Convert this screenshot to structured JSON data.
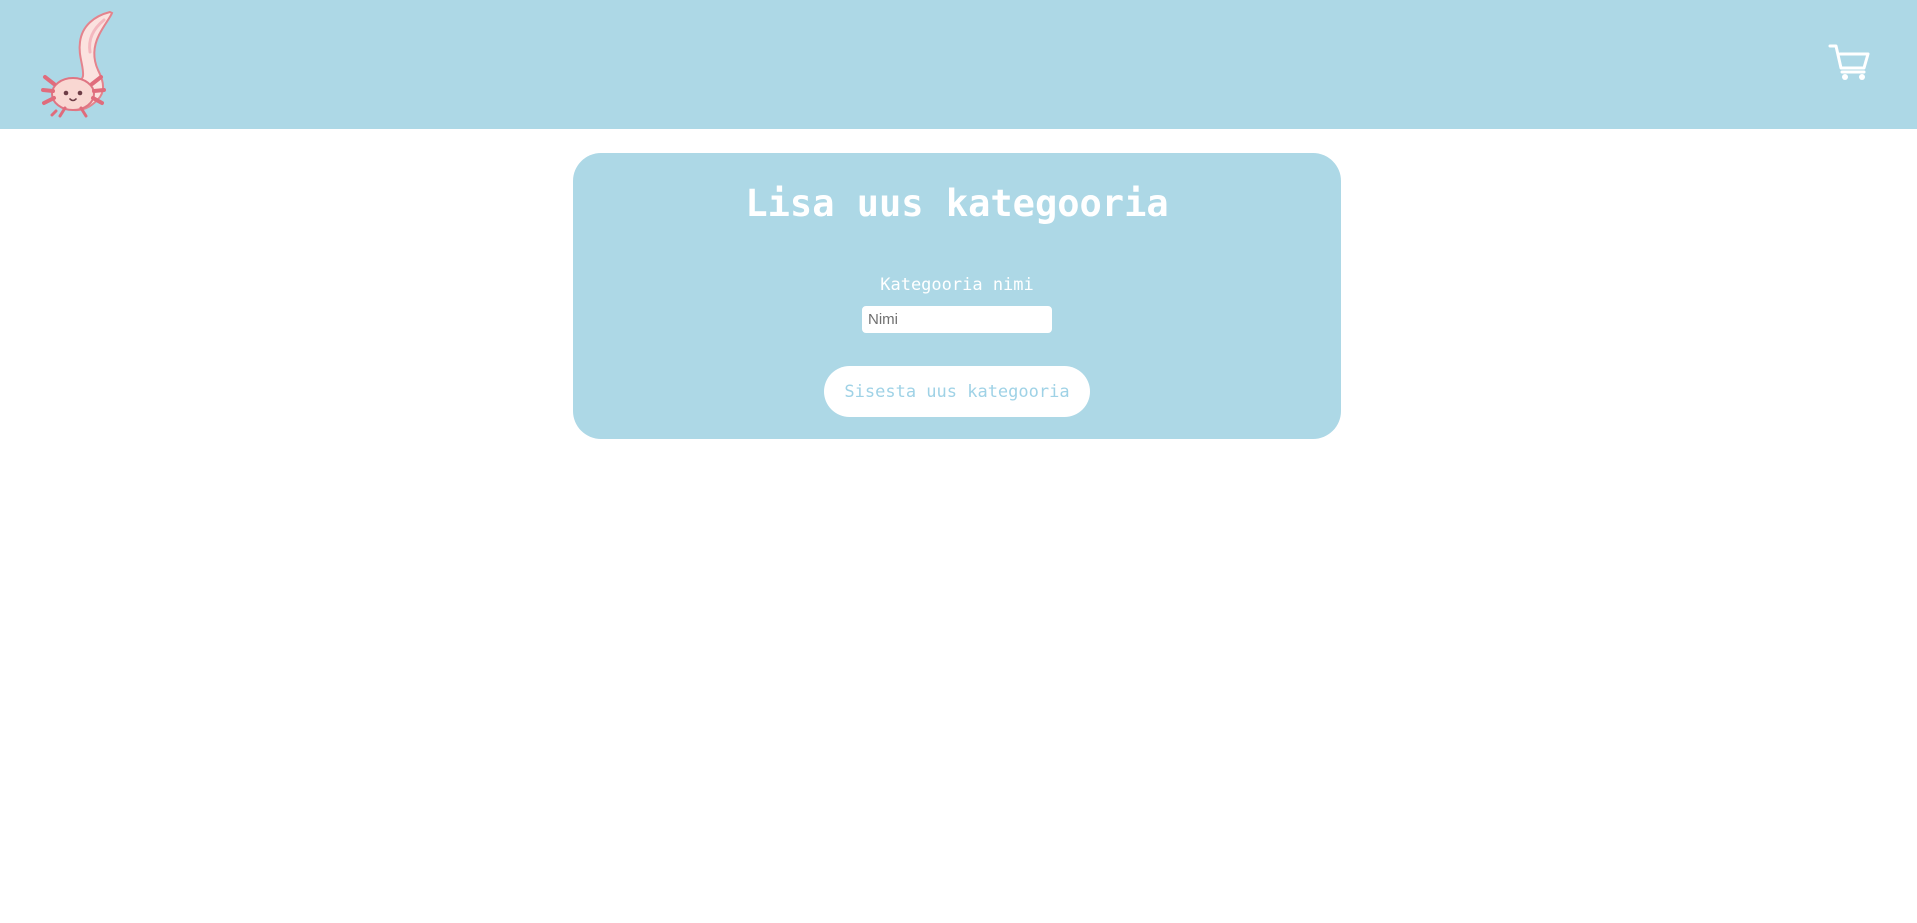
{
  "colors": {
    "header_background": "#add8e6",
    "card_background": "#add8e6",
    "page_background": "#ffffff",
    "button_text": "#9fd2e6"
  },
  "header": {
    "logo_icon": "axolotl-logo-icon",
    "cart_icon": "shopping-cart-icon"
  },
  "form": {
    "title": "Lisa uus kategooria",
    "name_label": "Kategooria nimi",
    "name_value": "",
    "name_placeholder": "Nimi",
    "submit_label": "Sisesta uus kategooria"
  }
}
